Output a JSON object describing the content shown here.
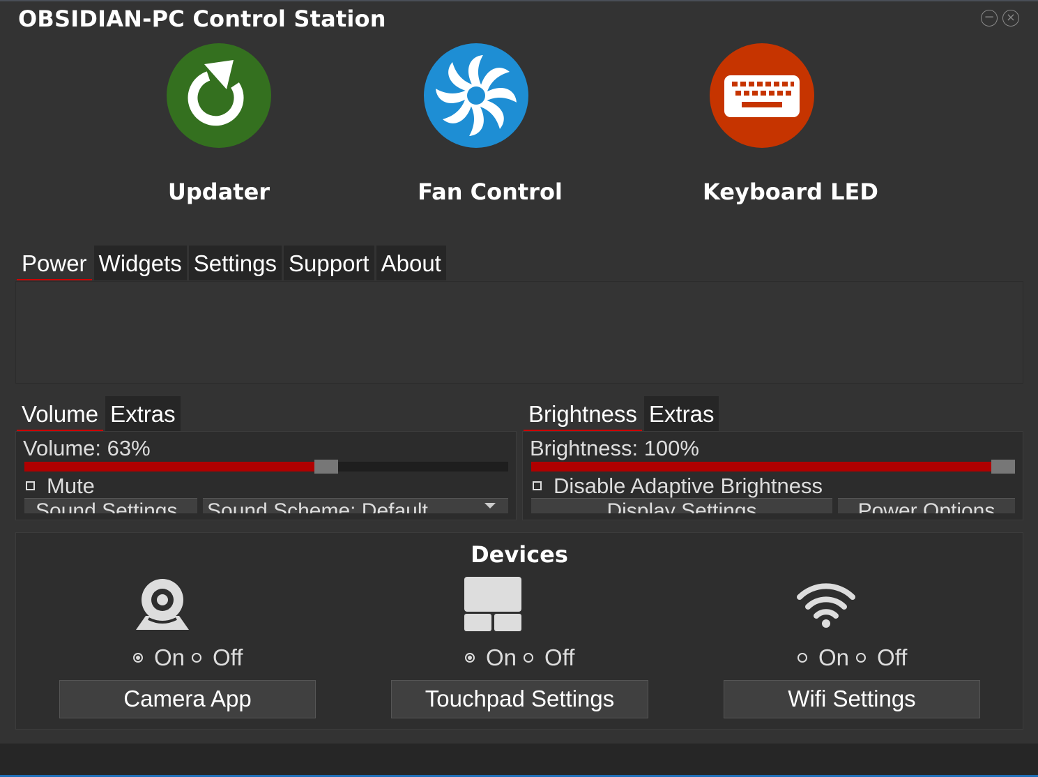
{
  "window": {
    "title": "OBSIDIAN-PC Control Station",
    "minimize_icon": "minimize-icon",
    "close_icon": "close-icon"
  },
  "apps": [
    {
      "label": "Updater",
      "icon": "refresh-icon",
      "color": "#34701f"
    },
    {
      "label": "Fan Control",
      "icon": "fan-icon",
      "color": "#1e8ed4"
    },
    {
      "label": "Keyboard LED",
      "icon": "keyboard-icon",
      "color": "#c63400"
    }
  ],
  "main_tabs": [
    "Power",
    "Widgets",
    "Settings",
    "Support",
    "About"
  ],
  "volume": {
    "tabs": [
      "Volume",
      "Extras"
    ],
    "label": "Volume: 63%",
    "level_percent": 63,
    "mute_label": "Mute",
    "sound_settings_label": "Sound Settings",
    "sound_scheme_label": "Sound Scheme: Default"
  },
  "brightness": {
    "tabs": [
      "Brightness",
      "Extras"
    ],
    "label": "Brightness: 100%",
    "level_percent": 100,
    "adaptive_label": "Disable Adaptive Brightness",
    "display_settings_label": "Display Settings",
    "power_options_label": "Power Options"
  },
  "devices": {
    "title": "Devices",
    "on_label": "On",
    "off_label": "Off",
    "items": [
      {
        "icon": "webcam-icon",
        "state": "on",
        "button": "Camera App"
      },
      {
        "icon": "touchpad-icon",
        "state": "on",
        "button": "Touchpad Settings"
      },
      {
        "icon": "wifi-icon",
        "state": "none",
        "button": "Wifi Settings"
      }
    ]
  },
  "colors": {
    "accent": "#cc0000",
    "slider_fill": "#b00000",
    "taskbar_accent": "#1f6fb8"
  }
}
